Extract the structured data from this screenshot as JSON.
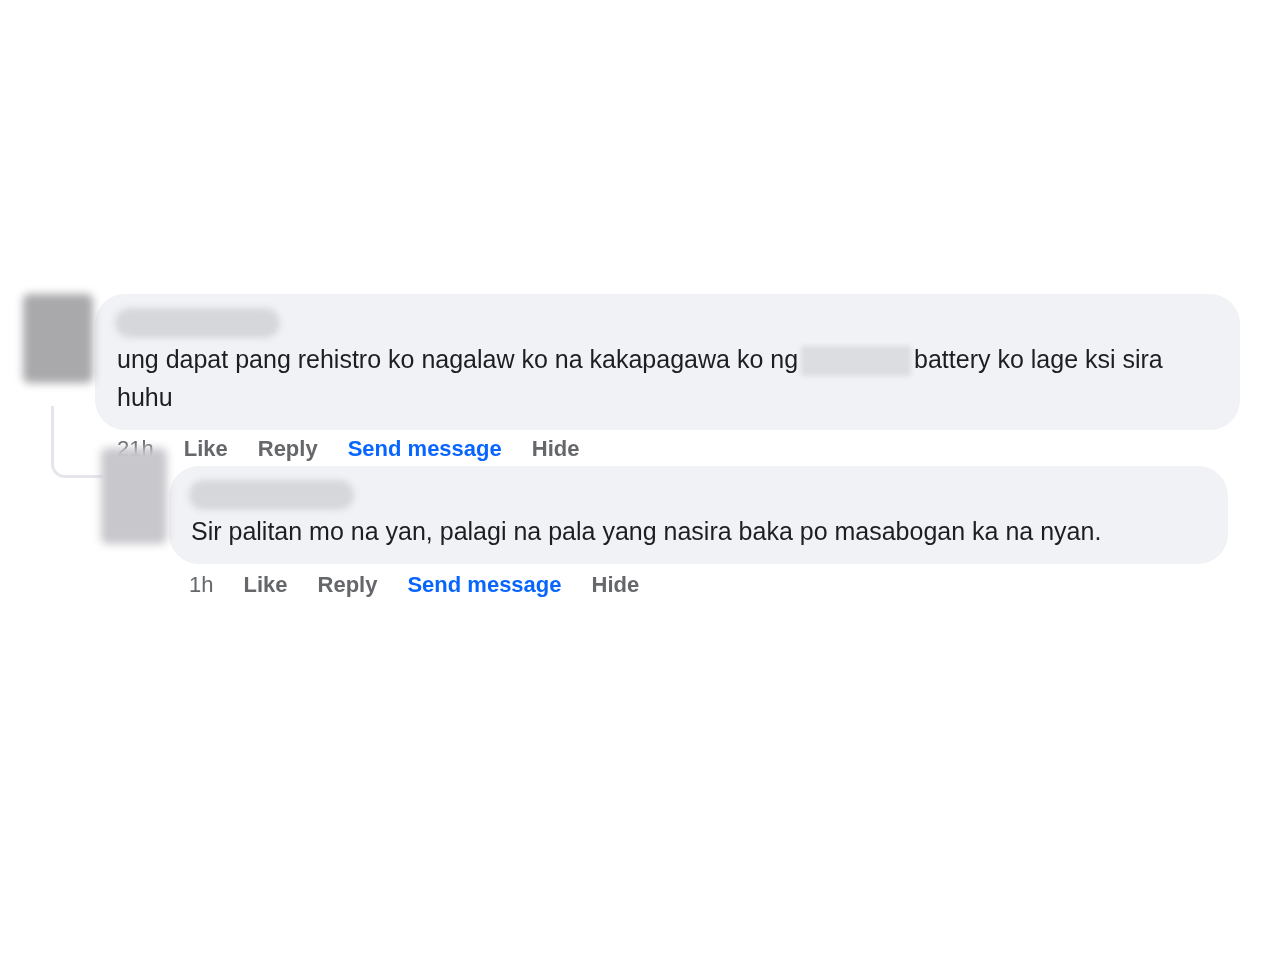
{
  "comments": [
    {
      "text_before": "ung dapat pang rehistro ko nagalaw ko na kakapagawa ko ng",
      "text_after": "battery ko lage ksi sira huhu",
      "time": "21h",
      "actions": [
        {
          "label": "Like",
          "kind": "plain"
        },
        {
          "label": "Reply",
          "kind": "plain"
        },
        {
          "label": "Send message",
          "kind": "accent"
        },
        {
          "label": "Hide",
          "kind": "plain"
        }
      ],
      "replies": [
        {
          "text_before": "Sir palitan mo na yan, palagi na pala yang nasira baka po masabogan ka na nyan.",
          "time": "1h",
          "actions": [
            {
              "label": "Like",
              "kind": "plain"
            },
            {
              "label": "Reply",
              "kind": "plain"
            },
            {
              "label": "Send message",
              "kind": "accent"
            },
            {
              "label": "Hide",
              "kind": "plain"
            }
          ]
        }
      ]
    }
  ]
}
